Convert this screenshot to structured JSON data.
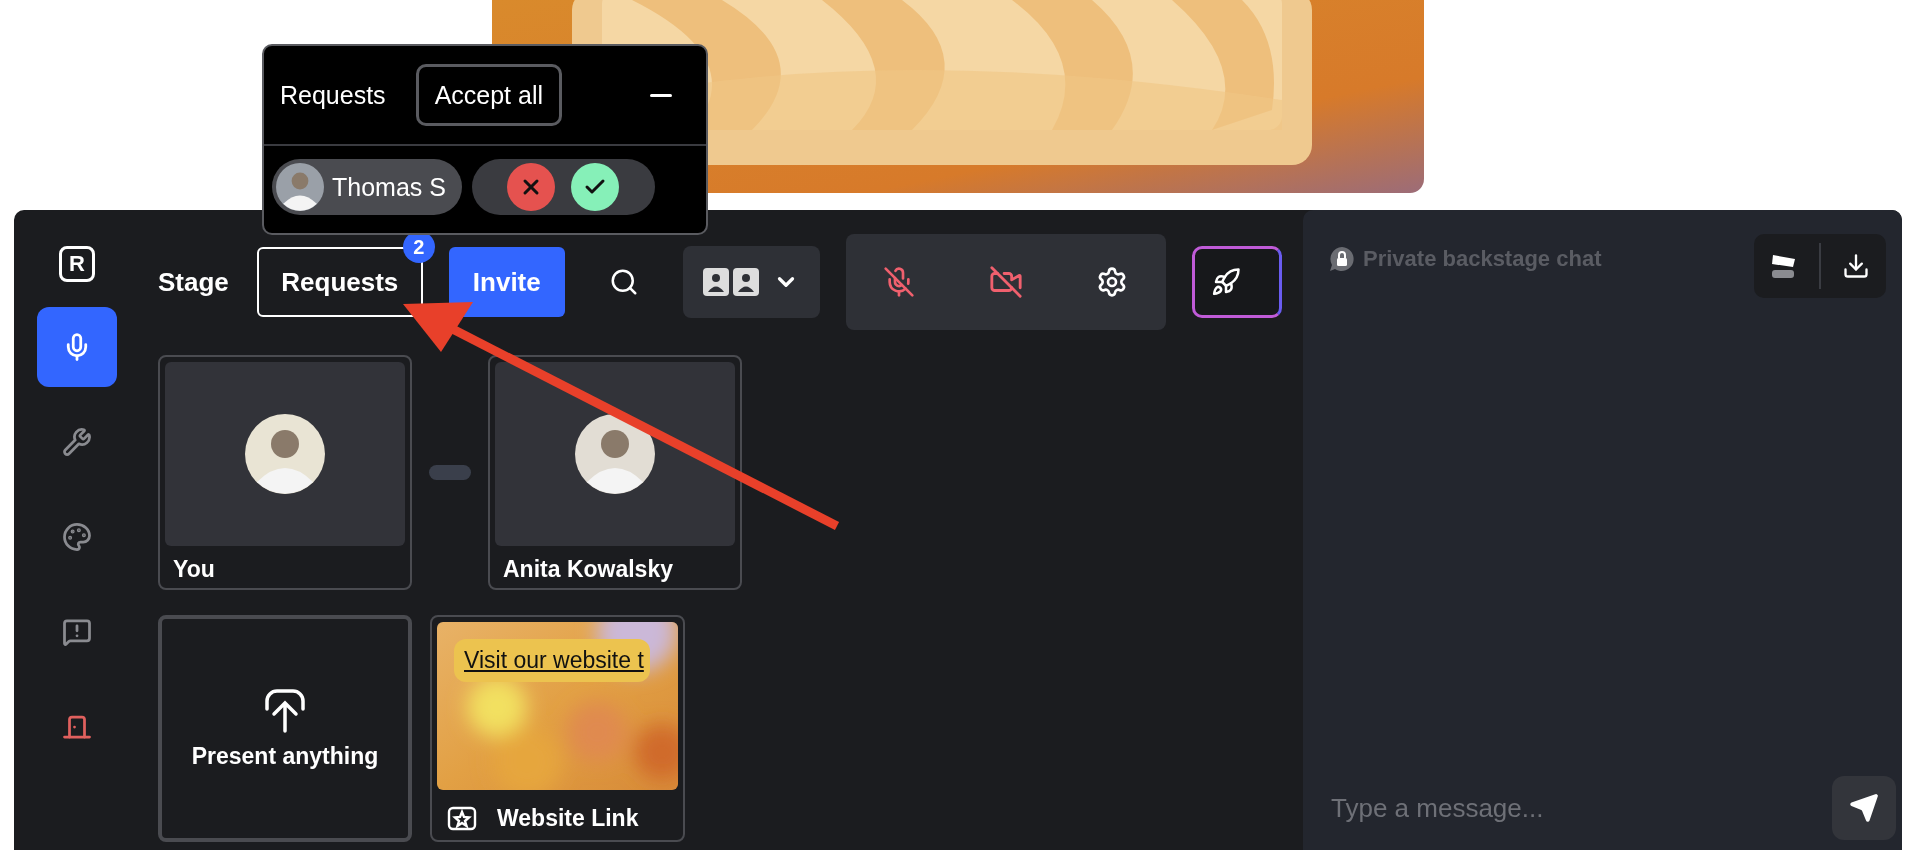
{
  "requests_popup": {
    "title": "Requests",
    "accept_all": "Accept all",
    "requests": [
      {
        "name": "Thomas S"
      }
    ]
  },
  "sidebar": {
    "logo": "R",
    "items": [
      {
        "kind": "mic",
        "selected": true
      },
      {
        "kind": "wrench",
        "selected": false
      },
      {
        "kind": "palette",
        "selected": false
      },
      {
        "kind": "feedback",
        "selected": false
      },
      {
        "kind": "exit",
        "selected": false
      }
    ]
  },
  "toolbar": {
    "title": "Stage",
    "requests_button": "Requests",
    "requests_badge": "2",
    "invite_button": "Invite"
  },
  "controls": [
    {
      "kind": "mic",
      "muted": true
    },
    {
      "kind": "camera",
      "muted": true
    },
    {
      "kind": "settings"
    }
  ],
  "stage": {
    "participants": [
      {
        "name": "You"
      },
      {
        "name": "Anita Kowalsky"
      }
    ]
  },
  "media": [
    {
      "kind": "upload",
      "label": "Present anything"
    },
    {
      "kind": "link",
      "label": "Website Link",
      "banner": "Visit our website t"
    }
  ],
  "chat": {
    "title": "Private backstage chat",
    "placeholder": "Type a message..."
  }
}
